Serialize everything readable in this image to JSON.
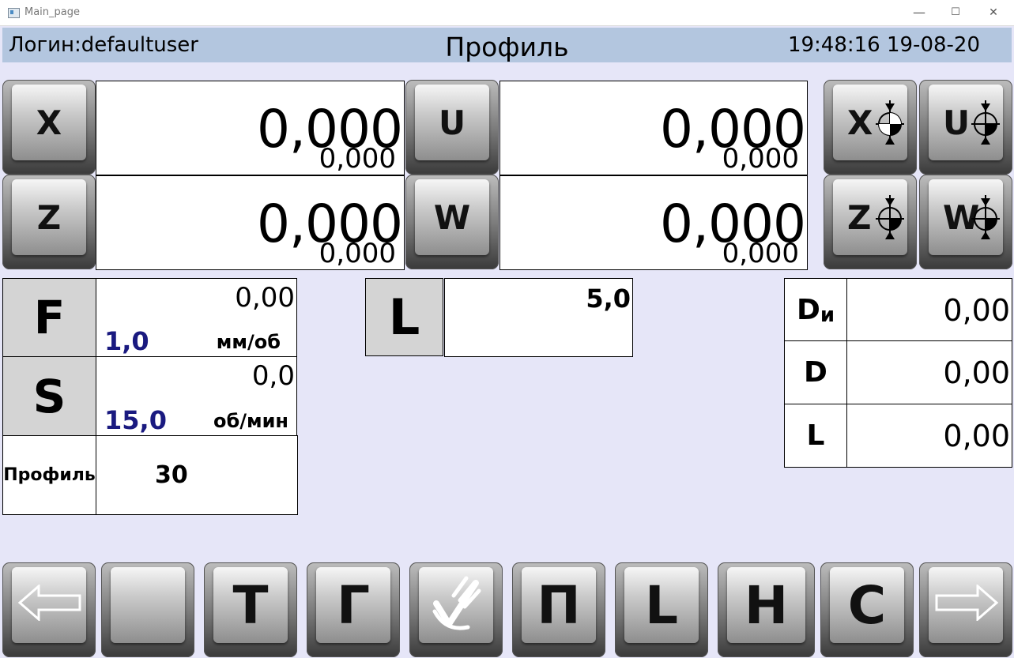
{
  "window": {
    "title": "Main_page",
    "minimize": "—",
    "maximize": "☐",
    "close": "✕"
  },
  "header": {
    "login": "Логин:defaultuser",
    "title": "Профиль",
    "datetime": "19:48:16 19-08-20"
  },
  "axes": [
    {
      "key": "x",
      "label": "X",
      "value": "0,000",
      "sub": "0,000"
    },
    {
      "key": "u",
      "label": "U",
      "value": "0,000",
      "sub": "0,000"
    },
    {
      "key": "z",
      "label": "Z",
      "value": "0,000",
      "sub": "0,000"
    },
    {
      "key": "w",
      "label": "W",
      "value": "0,000",
      "sub": "0,000"
    }
  ],
  "zero_buttons": [
    "X",
    "U",
    "Z",
    "W"
  ],
  "feed": {
    "label": "F",
    "actual": "0,00",
    "set": "1,0",
    "unit": "мм/об"
  },
  "speed": {
    "label": "S",
    "actual": "0,0",
    "set": "15,0",
    "unit": "об/мин"
  },
  "profile": {
    "label": "Профиль",
    "value": "30"
  },
  "length_param": {
    "label": "L",
    "value": "5,0"
  },
  "info": [
    {
      "label_main": "D",
      "label_sub": "и",
      "value": "0,00"
    },
    {
      "label_main": "D",
      "label_sub": "",
      "value": "0,00"
    },
    {
      "label_main": "L",
      "label_sub": "",
      "value": "0,00"
    }
  ],
  "bottom_buttons": [
    {
      "name": "prev-arrow",
      "label": "",
      "icon": "left-arrow-icon"
    },
    {
      "name": "blank",
      "label": "",
      "icon": ""
    },
    {
      "name": "t",
      "label": "Т",
      "icon": ""
    },
    {
      "name": "g",
      "label": "Г",
      "icon": ""
    },
    {
      "name": "manual",
      "label": "",
      "icon": "hand-check-icon"
    },
    {
      "name": "p",
      "label": "П",
      "icon": ""
    },
    {
      "name": "l",
      "label": "L",
      "icon": ""
    },
    {
      "name": "n",
      "label": "Н",
      "icon": ""
    },
    {
      "name": "s",
      "label": "С",
      "icon": ""
    },
    {
      "name": "next-arrow",
      "label": "",
      "icon": "right-arrow-icon"
    }
  ]
}
